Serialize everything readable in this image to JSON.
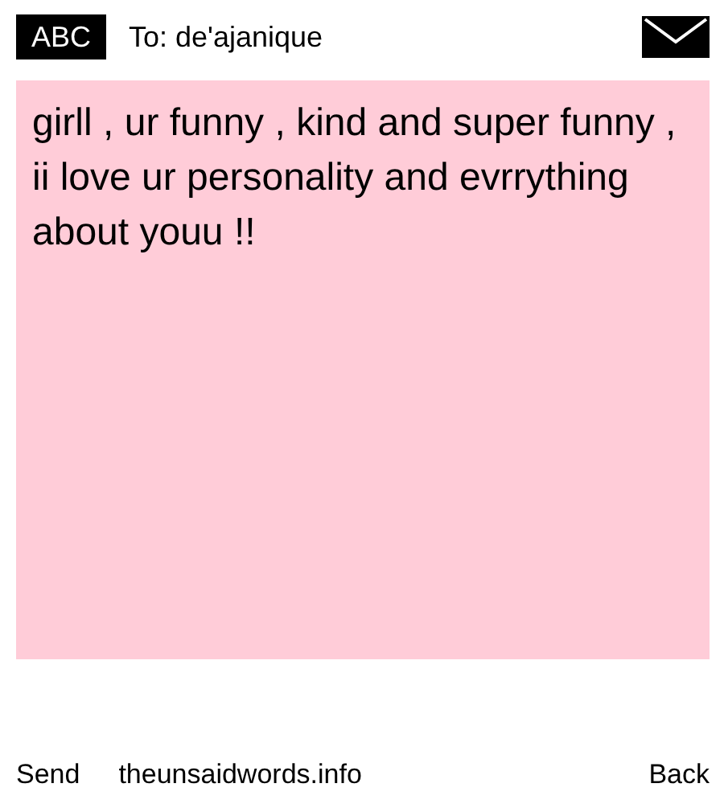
{
  "header": {
    "logo": "ABC",
    "recipient": "To: de'ajanique"
  },
  "message": "girll , ur funny , kind and super funny , ii love ur personality and evrrything about youu !!",
  "footer": {
    "send": "Send",
    "site": "theunsaidwords.info",
    "back": "Back"
  }
}
